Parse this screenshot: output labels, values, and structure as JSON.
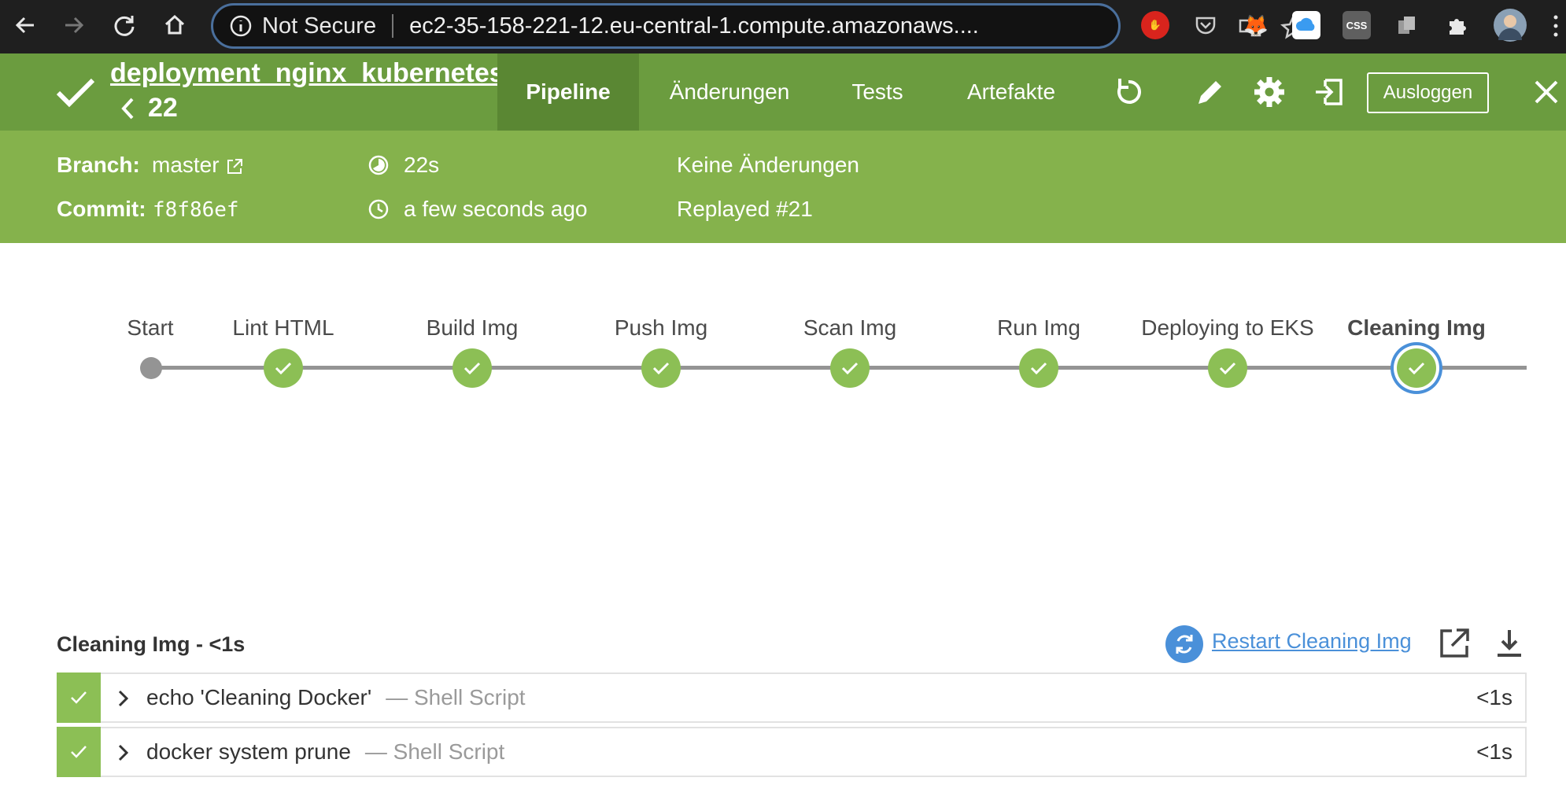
{
  "browser": {
    "security_label": "Not Secure",
    "url": "ec2-35-158-221-12.eu-central-1.compute.amazonaws....",
    "extensions": [
      {
        "name": "adblock",
        "color": "#d9241d",
        "label": "✋"
      },
      {
        "name": "pocket",
        "color": "#1f1f1f",
        "label": ""
      },
      {
        "name": "metamask",
        "color": "#1f1f1f",
        "label": "🦊"
      },
      {
        "name": "icloud",
        "color": "#ffffff",
        "label": ""
      },
      {
        "name": "css-viewer",
        "color": "#5f5f5f",
        "label": "CSS"
      },
      {
        "name": "copy",
        "color": "#1f1f1f",
        "label": ""
      },
      {
        "name": "puzzle",
        "color": "#1f1f1f",
        "label": ""
      }
    ]
  },
  "header": {
    "job_name": "deployment_nginx_kubernetes",
    "run_number": "22",
    "tabs": [
      {
        "label": "Pipeline",
        "active": true
      },
      {
        "label": "Änderungen",
        "active": false
      },
      {
        "label": "Tests",
        "active": false
      },
      {
        "label": "Artefakte",
        "active": false
      }
    ],
    "logout_label": "Ausloggen",
    "status_color": "#6b9c3f"
  },
  "run": {
    "branch_label": "Branch:",
    "branch": "master",
    "commit_label": "Commit:",
    "commit": "f8f86ef",
    "duration": "22s",
    "started": "a few seconds ago",
    "changes": "Keine Änderungen",
    "cause": "Replayed #21"
  },
  "pipeline": {
    "start_label": "Start",
    "stages": [
      {
        "name": "Lint HTML",
        "status": "success",
        "selected": false
      },
      {
        "name": "Build Img",
        "status": "success",
        "selected": false
      },
      {
        "name": "Push Img",
        "status": "success",
        "selected": false
      },
      {
        "name": "Scan Img",
        "status": "success",
        "selected": false
      },
      {
        "name": "Run Img",
        "status": "success",
        "selected": false
      },
      {
        "name": "Deploying to EKS",
        "status": "success",
        "selected": false
      },
      {
        "name": "Cleaning Img",
        "status": "success",
        "selected": true
      }
    ]
  },
  "stage_detail": {
    "title": "Cleaning Img - <1s",
    "restart_label": "Restart Cleaning Img",
    "steps": [
      {
        "command": "echo 'Cleaning Docker'",
        "kind": "— Shell Script",
        "duration": "<1s",
        "status": "success"
      },
      {
        "command": "docker system prune",
        "kind": "— Shell Script",
        "duration": "<1s",
        "status": "success"
      }
    ]
  }
}
